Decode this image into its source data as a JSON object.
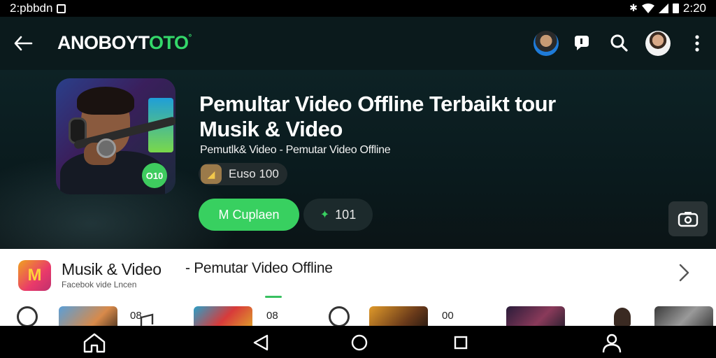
{
  "status_bar": {
    "time_left": "2:pbbdn",
    "time_right": "2:20"
  },
  "app_bar": {
    "logo_part1": "ANOBOYT",
    "logo_part2": "OTO",
    "logo_mark": "°"
  },
  "hero": {
    "thumb_badge": "O10",
    "title": "Pemultar Video Offline Terbaikt tour Musik & Video",
    "subtitle": "Pemutlk& Video - Pemutar Video Offline",
    "rating_chip": "Euso 100",
    "primary_button": "M Cuplaen",
    "secondary_button": "101",
    "colors": {
      "accent": "#38d060",
      "background": "#0b1a1c"
    }
  },
  "content": {
    "app_icon_letter": "M",
    "app_name": "Musik & Video",
    "developer": "Facebok vide Lncen",
    "tagline": "- Pemutar Video Offline",
    "row_counts": [
      "08",
      "08",
      "00"
    ]
  },
  "icons": {
    "back": "arrow-left-icon",
    "chat": "chat-bubble-icon",
    "search": "search-icon",
    "menu": "more-vert-icon",
    "camera": "camera-icon",
    "home": "home-icon",
    "nav_back": "triangle-back-icon",
    "nav_home": "circle-home-icon",
    "recents": "square-recents-icon",
    "profile": "person-icon"
  }
}
